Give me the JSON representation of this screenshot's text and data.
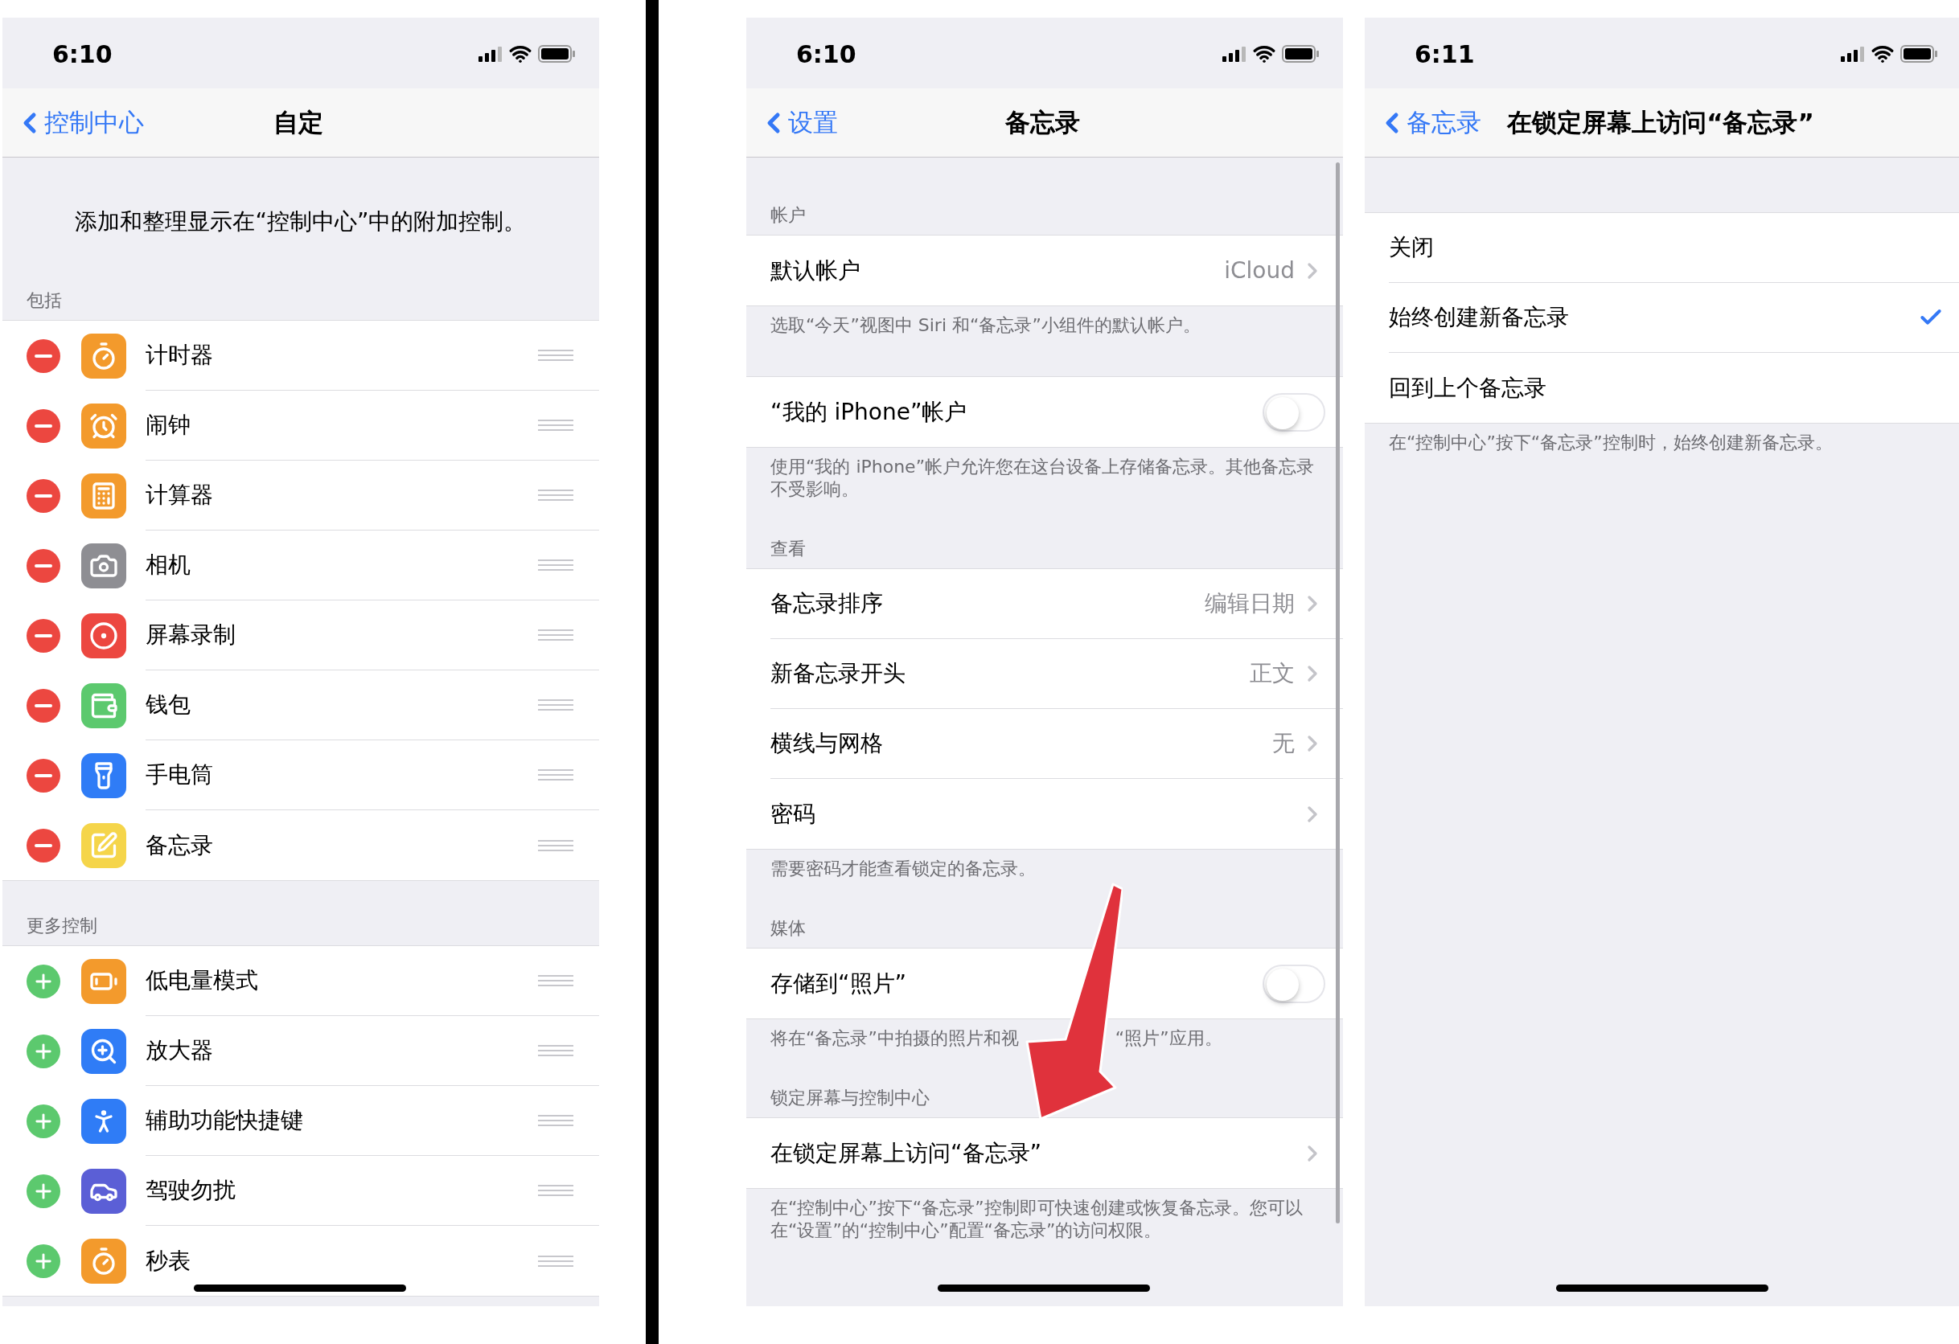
{
  "screens": [
    {
      "kind": "customize",
      "status_time": "6:10",
      "nav": {
        "back": "控制中心",
        "title": "自定"
      },
      "intro": "添加和整理显示在“控制中心”中的附加控制。",
      "sections": [
        {
          "header": "包括",
          "rows": [
            {
              "kind": "removable",
              "label": "计时器",
              "color": "#f39a2c"
            },
            {
              "kind": "removable",
              "label": "闹钟",
              "color": "#f39a2c"
            },
            {
              "kind": "removable",
              "label": "计算器",
              "color": "#f39a2c"
            },
            {
              "kind": "removable",
              "label": "相机",
              "color": "#8e8e93"
            },
            {
              "kind": "removable",
              "label": "屏幕录制",
              "color": "#ec4740"
            },
            {
              "kind": "removable",
              "label": "钱包",
              "color": "#5cc96e"
            },
            {
              "kind": "removable",
              "label": "手电筒",
              "color": "#2f7cf6"
            },
            {
              "kind": "removable",
              "label": "备忘录",
              "color": "#f5d54a"
            }
          ]
        },
        {
          "header": "更多控制",
          "rows": [
            {
              "kind": "addable",
              "label": "低电量模式",
              "color": "#f39a2c"
            },
            {
              "kind": "addable",
              "label": "放大器",
              "color": "#2f7cf6"
            },
            {
              "kind": "addable",
              "label": "辅助功能快捷键",
              "color": "#2f7cf6"
            },
            {
              "kind": "addable",
              "label": "驾驶勿扰",
              "color": "#5b5fd6"
            },
            {
              "kind": "addable",
              "label": "秒表",
              "color": "#f39a2c"
            }
          ]
        }
      ]
    },
    {
      "kind": "settings",
      "status_time": "6:10",
      "nav": {
        "back": "设置",
        "title": "备忘录"
      },
      "sections": [
        {
          "header": "帐户",
          "rows": [
            {
              "kind": "value",
              "label": "默认帐户",
              "value": "iCloud"
            }
          ],
          "footer": "选取“今天”视图中 Siri 和“备忘录”小组件的默认帐户。"
        },
        {
          "rows": [
            {
              "kind": "toggle",
              "label": "“我的 iPhone”帐户",
              "on": false
            }
          ],
          "footer": "使用“我的 iPhone”帐户允许您在这台设备上存储备忘录。其他备忘录不受影响。"
        },
        {
          "header": "查看",
          "rows": [
            {
              "kind": "value",
              "label": "备忘录排序",
              "value": "编辑日期"
            },
            {
              "kind": "value",
              "label": "新备忘录开头",
              "value": "正文"
            },
            {
              "kind": "value",
              "label": "横线与网格",
              "value": "无"
            },
            {
              "kind": "link",
              "label": "密码"
            }
          ],
          "footer": "需要密码才能查看锁定的备忘录。"
        },
        {
          "header": "媒体",
          "rows": [
            {
              "kind": "toggle",
              "label": "存储到“照片”",
              "on": false
            }
          ],
          "footer_parts": [
            "将在“备忘录”中拍摄的照片和视",
            "“照片”应用。"
          ]
        },
        {
          "header": "锁定屏幕与控制中心",
          "rows": [
            {
              "kind": "link",
              "label": "在锁定屏幕上访问“备忘录”"
            }
          ],
          "footer": "在“控制中心”按下“备忘录”控制即可快速创建或恢复备忘录。您可以在“设置”的“控制中心”配置“备忘录”的访问权限。"
        }
      ]
    },
    {
      "kind": "options",
      "status_time": "6:11",
      "nav": {
        "back": "备忘录",
        "title": "在锁定屏幕上访问“备忘录”"
      },
      "sections": [
        {
          "rows": [
            {
              "kind": "option",
              "label": "关闭",
              "selected": false
            },
            {
              "kind": "option",
              "label": "始终创建新备忘录",
              "selected": true
            },
            {
              "kind": "option",
              "label": "回到上个备忘录",
              "selected": false
            }
          ],
          "footer": "在“控制中心”按下“备忘录”控制时，始终创建新备忘录。"
        }
      ]
    }
  ]
}
